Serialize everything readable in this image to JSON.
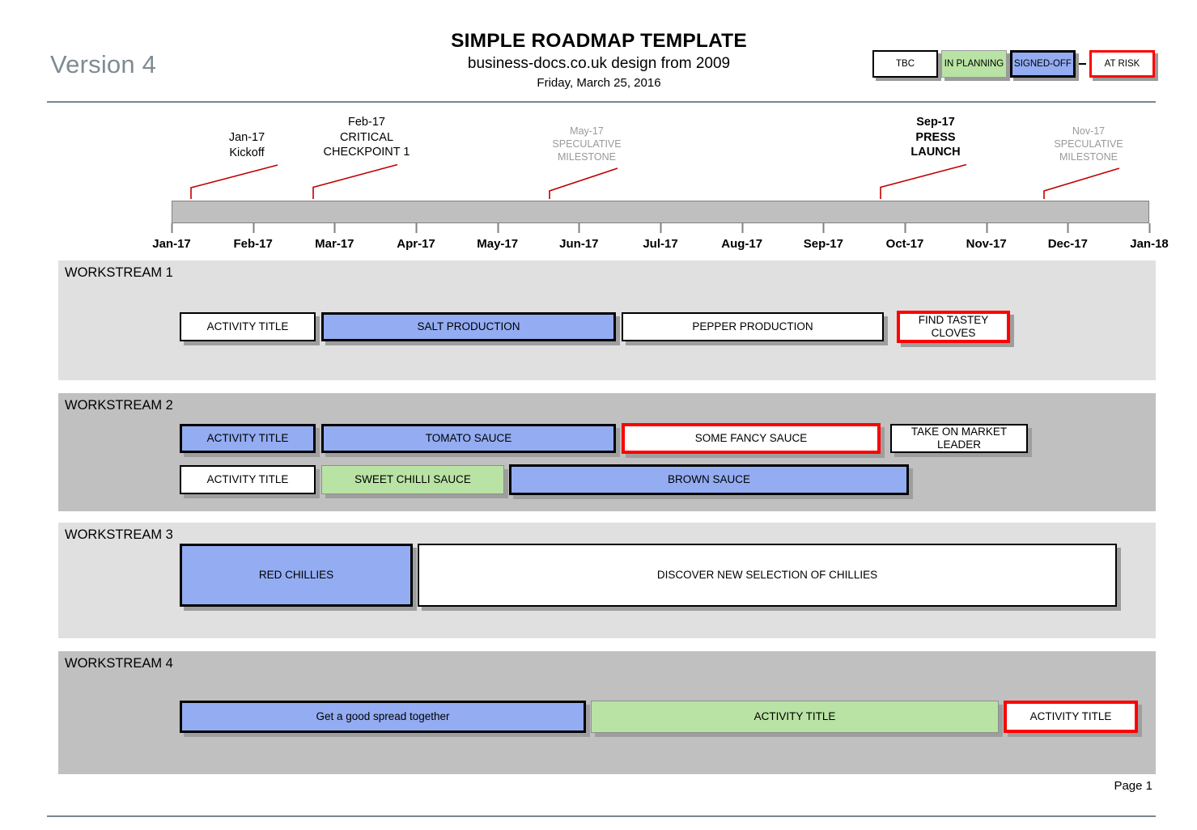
{
  "header": {
    "version": "Version 4",
    "title": "SIMPLE ROADMAP TEMPLATE",
    "subtitle": "business-docs.co.uk design from 2009",
    "date": "Friday, March 25, 2016"
  },
  "legend": {
    "items": [
      {
        "label": "TBC",
        "style": "tbc",
        "color": "#ffffff"
      },
      {
        "label": "IN PLANNING",
        "style": "planning",
        "color": "#b9e3a4"
      },
      {
        "label": "SIGNED-OFF",
        "style": "signed",
        "color": "#93acf2"
      },
      {
        "label": "AT RISK",
        "style": "atrisk",
        "color": "#fe0000"
      }
    ]
  },
  "timeline": {
    "months": [
      "Jan-17",
      "Feb-17",
      "Mar-17",
      "Apr-17",
      "May-17",
      "Jun-17",
      "Jul-17",
      "Aug-17",
      "Sep-17",
      "Oct-17",
      "Nov-17",
      "Dec-17",
      "Jan-18"
    ],
    "bar_color": "#bfbfbf",
    "marker_color": "#e8380d"
  },
  "milestones": [
    {
      "date": "Jan-17",
      "name": "Kickoff",
      "lines": [
        "Jan-17",
        "Kickoff"
      ],
      "marker": "cross-marker",
      "emphasis": "normal"
    },
    {
      "date": "Feb-17",
      "name": "CRITICAL CHECKPOINT 1",
      "lines": [
        "Feb-17",
        "CRITICAL",
        "CHECKPOINT 1"
      ],
      "marker": "cross-marker",
      "emphasis": "normal"
    },
    {
      "date": "May-17",
      "name": "SPECULATIVE MILESTONE",
      "lines": [
        "May-17",
        "SPECULATIVE",
        "MILESTONE"
      ],
      "marker": "arrow-marker",
      "emphasis": "muted"
    },
    {
      "date": "Sep-17",
      "name": "PRESS LAUNCH",
      "lines": [
        "Sep-17",
        "PRESS",
        "LAUNCH"
      ],
      "marker": "arrow-marker",
      "emphasis": "bold"
    },
    {
      "date": "Nov-17",
      "name": "SPECULATIVE MILESTONE",
      "lines": [
        "Nov-17",
        "SPECULATIVE",
        "MILESTONE"
      ],
      "marker": "arrow-marker",
      "emphasis": "muted"
    }
  ],
  "workstreams": [
    {
      "title": "WORKSTREAM 1",
      "shade": "light",
      "rows": [
        [
          {
            "label": "ACTIVITY TITLE",
            "status": "tbc"
          },
          {
            "label": "SALT PRODUCTION",
            "status": "signed"
          },
          {
            "label": "PEPPER PRODUCTION",
            "status": "tbc"
          },
          {
            "label": "FIND TASTEY CLOVES",
            "status": "atrisk"
          }
        ]
      ]
    },
    {
      "title": "WORKSTREAM 2",
      "shade": "dark",
      "rows": [
        [
          {
            "label": "ACTIVITY TITLE",
            "status": "signed"
          },
          {
            "label": "TOMATO SAUCE",
            "status": "signed"
          },
          {
            "label": "SOME FANCY SAUCE",
            "status": "atrisk"
          },
          {
            "label": "TAKE ON MARKET LEADER",
            "status": "tbc"
          }
        ],
        [
          {
            "label": "ACTIVITY TITLE",
            "status": "tbc"
          },
          {
            "label": "SWEET CHILLI SAUCE",
            "status": "planning"
          },
          {
            "label": "BROWN SAUCE",
            "status": "signed"
          }
        ]
      ]
    },
    {
      "title": "WORKSTREAM 3",
      "shade": "light",
      "rows": [
        [
          {
            "label": "RED CHILLIES",
            "status": "signed"
          },
          {
            "label": "DISCOVER NEW SELECTION OF CHILLIES",
            "status": "tbc"
          }
        ]
      ]
    },
    {
      "title": "WORKSTREAM 4",
      "shade": "dark",
      "rows": [
        [
          {
            "label": "Get a good spread together",
            "status": "signed"
          },
          {
            "label": "ACTIVITY TITLE",
            "status": "planning"
          },
          {
            "label": "ACTIVITY TITLE",
            "status": "atrisk"
          }
        ]
      ]
    }
  ],
  "footer": {
    "page": "Page 1"
  }
}
